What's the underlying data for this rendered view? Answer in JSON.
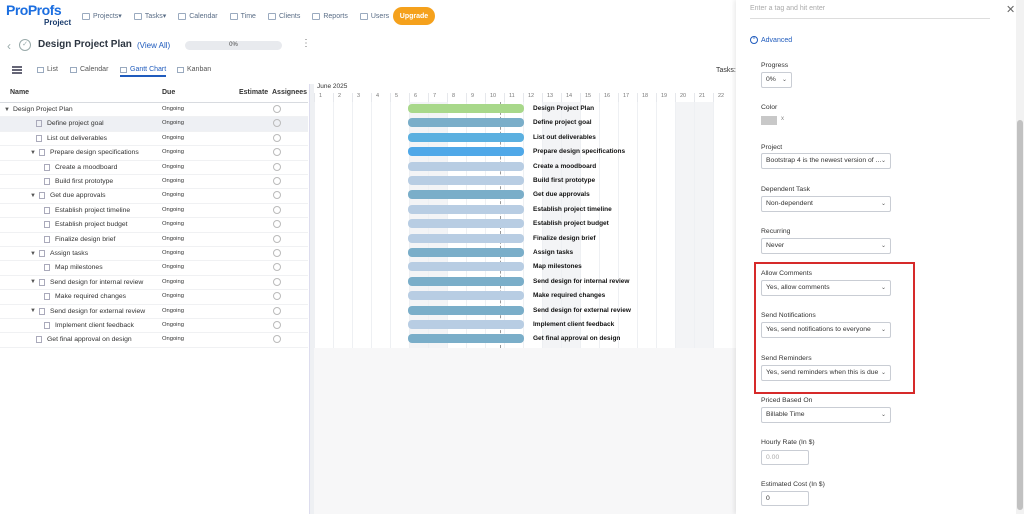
{
  "brand": {
    "logo_main": "ProProfs",
    "logo_sub": "Project"
  },
  "nav": {
    "items": [
      "Projects",
      "Tasks",
      "Calendar",
      "Time",
      "Clients",
      "Reports",
      "Users"
    ],
    "upgrade": "Upgrade"
  },
  "project": {
    "title": "Design Project Plan",
    "view_all": "(View All)",
    "progress": "0%"
  },
  "views": {
    "list": "List",
    "calendar": "Calendar",
    "gantt": "Gantt Chart",
    "kanban": "Kanban",
    "tasks_label": "Tasks:"
  },
  "grid": {
    "headers": {
      "name": "Name",
      "due": "Due",
      "estimate": "Estimate",
      "assignees": "Assignees"
    },
    "rows": [
      {
        "name": "Design Project Plan",
        "due": "Ongoing"
      },
      {
        "name": "Define project goal",
        "due": "Ongoing"
      },
      {
        "name": "List out deliverables",
        "due": "Ongoing"
      },
      {
        "name": "Prepare design specifications",
        "due": "Ongoing"
      },
      {
        "name": "Create a moodboard",
        "due": "Ongoing"
      },
      {
        "name": "Build first prototype",
        "due": "Ongoing"
      },
      {
        "name": "Get due approvals",
        "due": "Ongoing"
      },
      {
        "name": "Establish project timeline",
        "due": "Ongoing"
      },
      {
        "name": "Establish project budget",
        "due": "Ongoing"
      },
      {
        "name": "Finalize design brief",
        "due": "Ongoing"
      },
      {
        "name": "Assign tasks",
        "due": "Ongoing"
      },
      {
        "name": "Map milestones",
        "due": "Ongoing"
      },
      {
        "name": "Send design for internal review",
        "due": "Ongoing"
      },
      {
        "name": "Make required changes",
        "due": "Ongoing"
      },
      {
        "name": "Send design for external review",
        "due": "Ongoing"
      },
      {
        "name": "Implement client feedback",
        "due": "Ongoing"
      },
      {
        "name": "Get final approval on design",
        "due": "Ongoing"
      }
    ]
  },
  "gantt": {
    "month": "June 2025",
    "days": [
      "1",
      "2",
      "3",
      "4",
      "5",
      "6",
      "7",
      "8",
      "9",
      "10",
      "11",
      "12",
      "13",
      "14",
      "15",
      "16",
      "17",
      "18",
      "19",
      "20",
      "21",
      "22"
    ],
    "bar_colors": [
      "#a8d88a",
      "#7aaec9",
      "#5bb0e0",
      "#4fa8e8",
      "#b8cde3",
      "#b8cde3",
      "#7aaec9",
      "#b8cde3",
      "#b8cde3",
      "#b8cde3",
      "#7aaec9",
      "#b8cde3",
      "#7aaec9",
      "#b8cde3",
      "#7aaec9",
      "#b8cde3",
      "#7aaec9"
    ]
  },
  "panel": {
    "tag_placeholder": "Enter a tag and hit enter",
    "advanced": "Advanced",
    "progress_label": "Progress",
    "progress_value": "0%",
    "color_label": "Color",
    "color_x": "x",
    "project_label": "Project",
    "project_value": "Bootstrap 4 is the newest version of ...",
    "dependent_label": "Dependent Task",
    "dependent_value": "Non-dependent",
    "recurring_label": "Recurring",
    "recurring_value": "Never",
    "comments_label": "Allow Comments",
    "comments_value": "Yes, allow comments",
    "notif_label": "Send Notifications",
    "notif_value": "Yes, send notifications to everyone",
    "remind_label": "Send Reminders",
    "remind_value": "Yes, send reminders when this is due",
    "priced_label": "Priced Based On",
    "priced_value": "Billable Time",
    "rate_label": "Hourly Rate (In $)",
    "rate_placeholder": "0.00",
    "cost_label": "Estimated Cost (In $)",
    "cost_value": "0"
  }
}
